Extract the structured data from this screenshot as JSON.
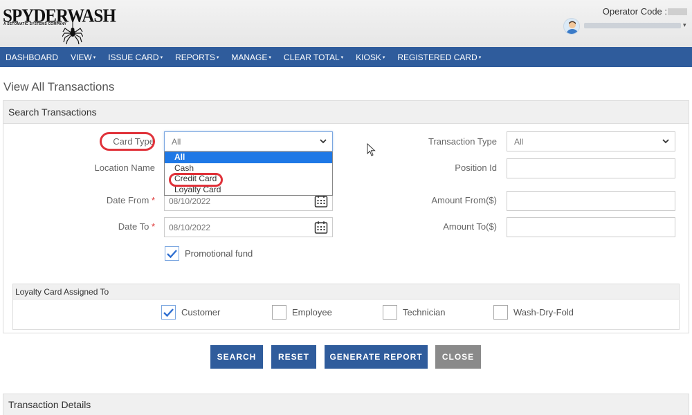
{
  "header": {
    "logo_main": "SPYDERWASH",
    "logo_sub": "A SETOMATIC SYSTEMS COMPANY",
    "operator_label": "Operator Code :",
    "user_menu_icon": "chevron-down-icon"
  },
  "nav": {
    "items": [
      {
        "label": "DASHBOARD",
        "has_caret": false
      },
      {
        "label": "VIEW",
        "has_caret": true
      },
      {
        "label": "ISSUE CARD",
        "has_caret": true
      },
      {
        "label": "REPORTS",
        "has_caret": true
      },
      {
        "label": "MANAGE",
        "has_caret": true
      },
      {
        "label": "CLEAR TOTAL",
        "has_caret": true
      },
      {
        "label": "KIOSK",
        "has_caret": true
      },
      {
        "label": "REGISTERED CARD",
        "has_caret": true
      }
    ],
    "caret": "▾"
  },
  "page_title": "View All Transactions",
  "search": {
    "title": "Search Transactions",
    "card_type": {
      "label": "Card Type",
      "value": "All",
      "options": [
        "All",
        "Cash",
        "Credit Card",
        "Loyalty Card"
      ]
    },
    "location_name": {
      "label": "Location Name",
      "value": ""
    },
    "date_from": {
      "label": "Date From",
      "required_mark": "*",
      "value": "08/10/2022"
    },
    "date_to": {
      "label": "Date To",
      "required_mark": "*",
      "value": "08/10/2022"
    },
    "promotional_fund": {
      "label": "Promotional fund",
      "checked": true
    },
    "transaction_type": {
      "label": "Transaction Type",
      "value": "All"
    },
    "position_id": {
      "label": "Position Id",
      "value": ""
    },
    "amount_from": {
      "label": "Amount From($)",
      "value": ""
    },
    "amount_to": {
      "label": "Amount To($)",
      "value": ""
    }
  },
  "loyalty": {
    "title": "Loyalty Card Assigned To",
    "options": [
      {
        "label": "Customer",
        "checked": true
      },
      {
        "label": "Employee",
        "checked": false
      },
      {
        "label": "Technician",
        "checked": false
      },
      {
        "label": "Wash-Dry-Fold",
        "checked": false
      }
    ]
  },
  "buttons": {
    "search": "SEARCH",
    "reset": "RESET",
    "generate_report": "GENERATE REPORT",
    "close": "CLOSE"
  },
  "details": {
    "title": "Transaction Details"
  },
  "colors": {
    "nav": "#2f5c9c",
    "highlight": "#e0323a",
    "selected_option": "#1e78e6",
    "close_button": "#8a8a8a"
  }
}
